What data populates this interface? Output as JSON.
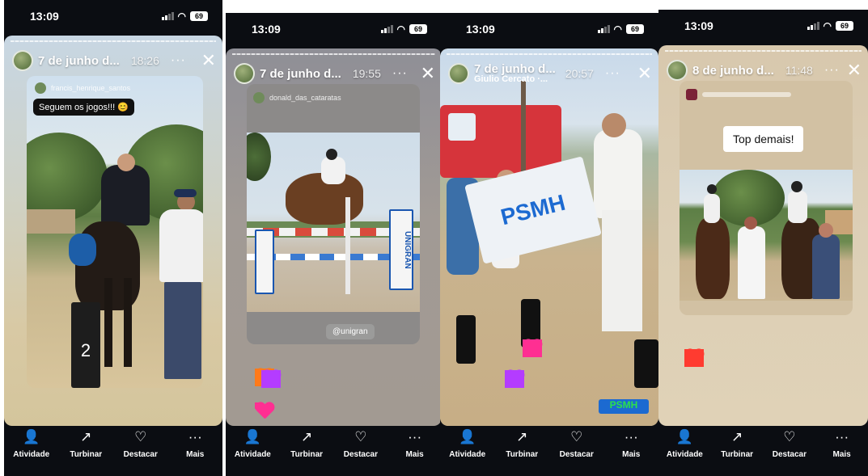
{
  "stories": [
    {
      "status": {
        "time": "13:09",
        "battery": "69"
      },
      "header": {
        "title": "7 de junho d...",
        "subtitle": "",
        "time": "18:26",
        "more": "···",
        "close": "✕"
      },
      "repost_user": "francis_henrique_santos",
      "caption": "Seguem os jogos!!! 😊",
      "post_number": "2"
    },
    {
      "status": {
        "time": "13:09",
        "battery": "69"
      },
      "header": {
        "title": "7 de junho d...",
        "subtitle": "",
        "time": "19:55",
        "more": "···",
        "close": "✕"
      },
      "repost_user": "donald_das_cataratas",
      "mention": "@unigran",
      "banner_text": "UNIGRAN"
    },
    {
      "status": {
        "time": "13:09",
        "battery": "69"
      },
      "header": {
        "title": "7 de junho d...",
        "subtitle": "Giulio Cercato ·...",
        "time": "20:57",
        "more": "···",
        "close": "✕"
      },
      "banner_text": "PSMH"
    },
    {
      "status": {
        "time": "13:09",
        "battery": "69"
      },
      "header": {
        "title": "8 de junho d...",
        "subtitle": "",
        "time": "11:48",
        "more": "···",
        "close": "✕"
      },
      "text_card": "Top demais!"
    }
  ],
  "actions": [
    {
      "label": "Atividade",
      "icon": "person-icon"
    },
    {
      "label": "Turbinar",
      "icon": "trend-up-icon"
    },
    {
      "label": "Destacar",
      "icon": "highlight-heart-icon"
    },
    {
      "label": "Mais",
      "icon": "more-dots-icon"
    }
  ],
  "colors": {
    "background": "#0b0d12",
    "heart_red": "#ff3b30",
    "heart_pink": "#ff2f92",
    "heart_purple": "#9b30ff"
  }
}
